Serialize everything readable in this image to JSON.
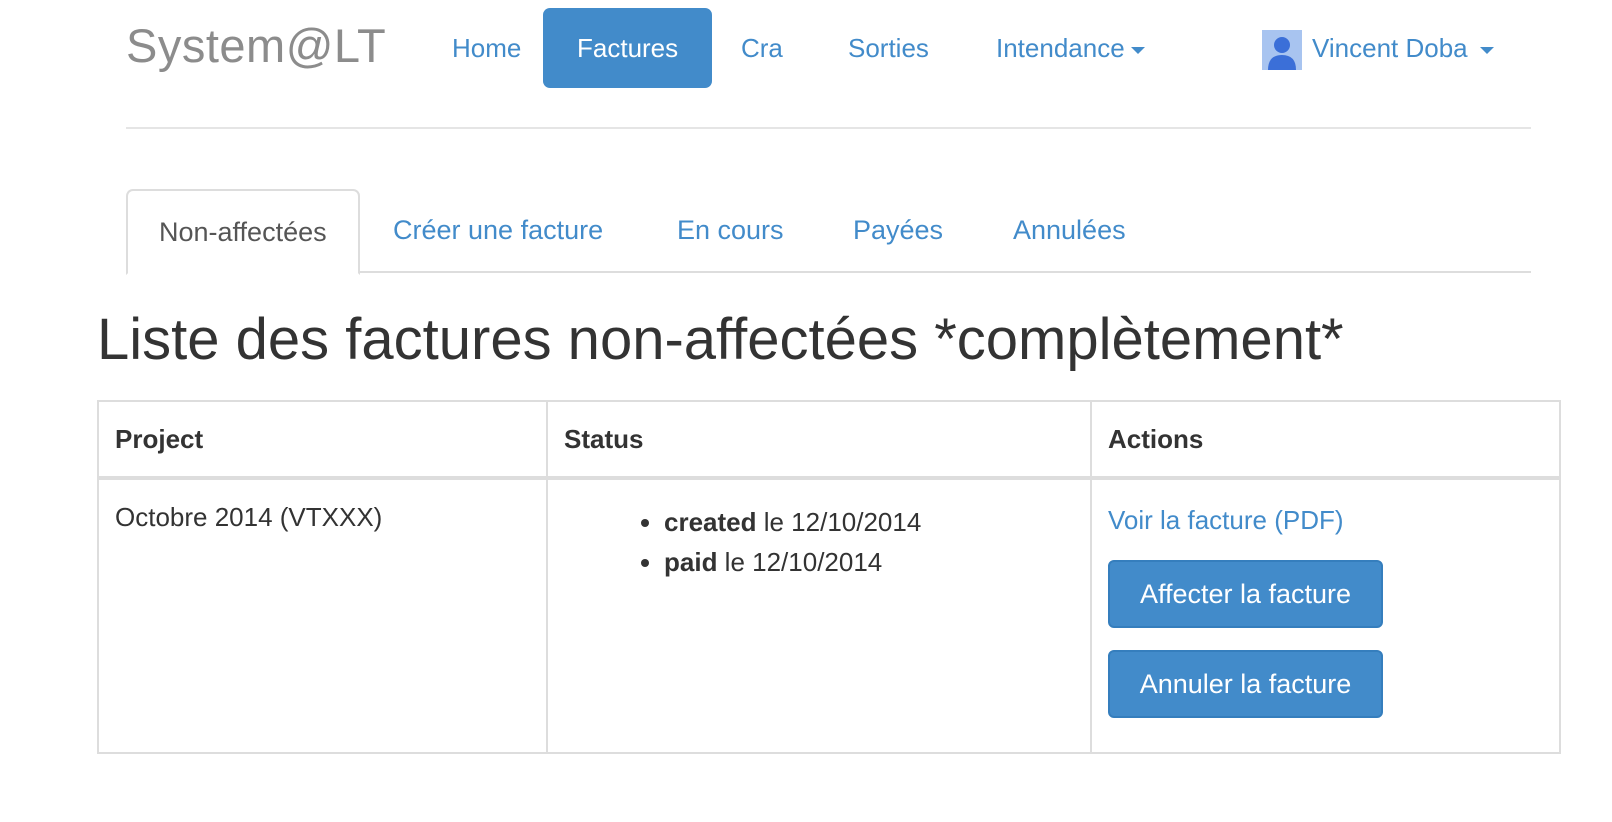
{
  "app": {
    "brand": "System@LT"
  },
  "navbar": {
    "items": [
      {
        "label": "Home"
      },
      {
        "label": "Factures"
      },
      {
        "label": "Cra"
      },
      {
        "label": "Sorties"
      },
      {
        "label": "Intendance"
      }
    ],
    "active": "Factures",
    "user": {
      "name": "Vincent Doba",
      "icon": "user-avatar-icon"
    },
    "colors": {
      "accent": "#428bca",
      "brand_text": "#8c8c8c"
    }
  },
  "tabs": [
    {
      "label": "Non-affectées"
    },
    {
      "label": "Créer une facture"
    },
    {
      "label": "En cours"
    },
    {
      "label": "Payées"
    },
    {
      "label": "Annulées"
    }
  ],
  "active_tab": "Non-affectées",
  "page_title": "Liste des factures non-affectées *complètement*",
  "table": {
    "headers": [
      "Project",
      "Status",
      "Actions"
    ],
    "rows": [
      {
        "project": "Octobre 2014 (VTXXX)",
        "status": [
          {
            "state": "created",
            "text": " le 12/10/2014"
          },
          {
            "state": "paid",
            "text": " le 12/10/2014"
          }
        ],
        "actions": {
          "view_pdf": "Voir la facture (PDF)",
          "assign": "Affecter la facture",
          "cancel": "Annuler la facture"
        }
      }
    ]
  }
}
